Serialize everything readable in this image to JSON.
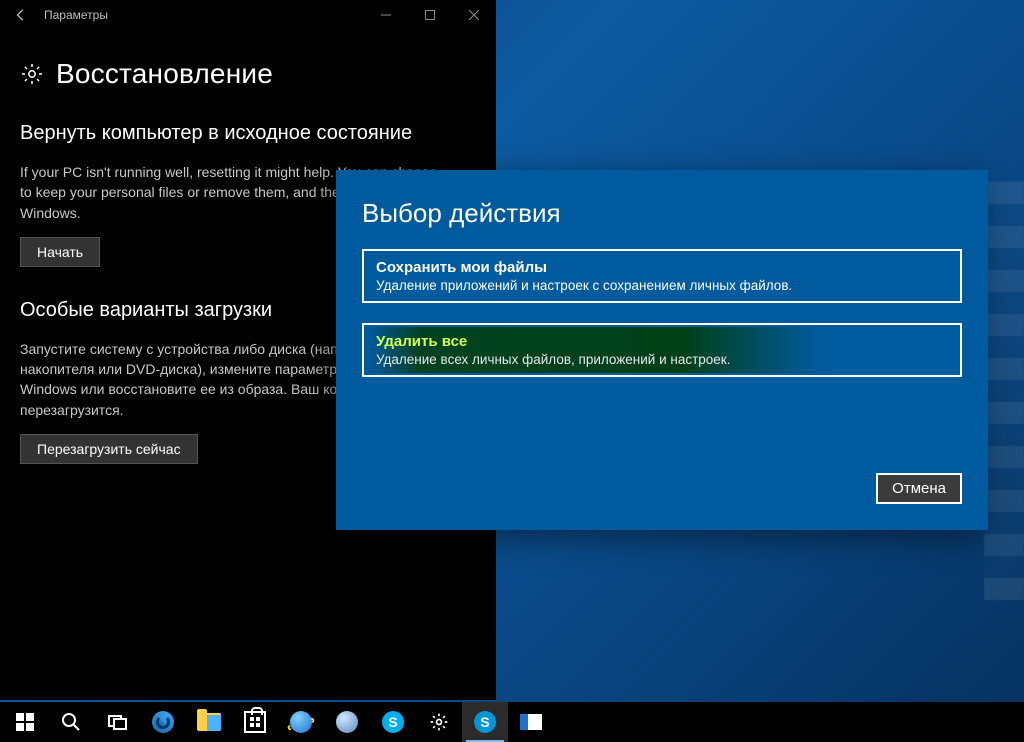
{
  "settings": {
    "window_title": "Параметры",
    "page_title": "Восстановление",
    "reset": {
      "heading": "Вернуть компьютер в исходное состояние",
      "description": "If your PC isn't running well, resetting it might help. You can choose to keep your personal files or remove them, and then reinstalls Windows.",
      "button": "Начать"
    },
    "advanced": {
      "heading": "Особые варианты загрузки",
      "description": "Запустите систему с устройства либо диска (например, USB-накопителя или DVD-диска), измените параметры загрузки Windows или восстановите ее из образа. Ваш компьютер перезагрузится.",
      "button": "Перезагрузить сейчас"
    }
  },
  "dialog": {
    "title": "Выбор действия",
    "options": [
      {
        "title": "Сохранить мои файлы",
        "desc": "Удаление приложений и настроек с сохранением личных файлов."
      },
      {
        "title": "Удалить все",
        "desc": "Удаление всех личных файлов, приложений и настроек."
      }
    ],
    "cancel": "Отмена"
  },
  "taskbar": {
    "items": [
      "start",
      "search",
      "task-view",
      "edge",
      "file-explorer",
      "store",
      "internet-explorer",
      "globe",
      "skype",
      "settings",
      "skype-preview",
      "app"
    ]
  }
}
